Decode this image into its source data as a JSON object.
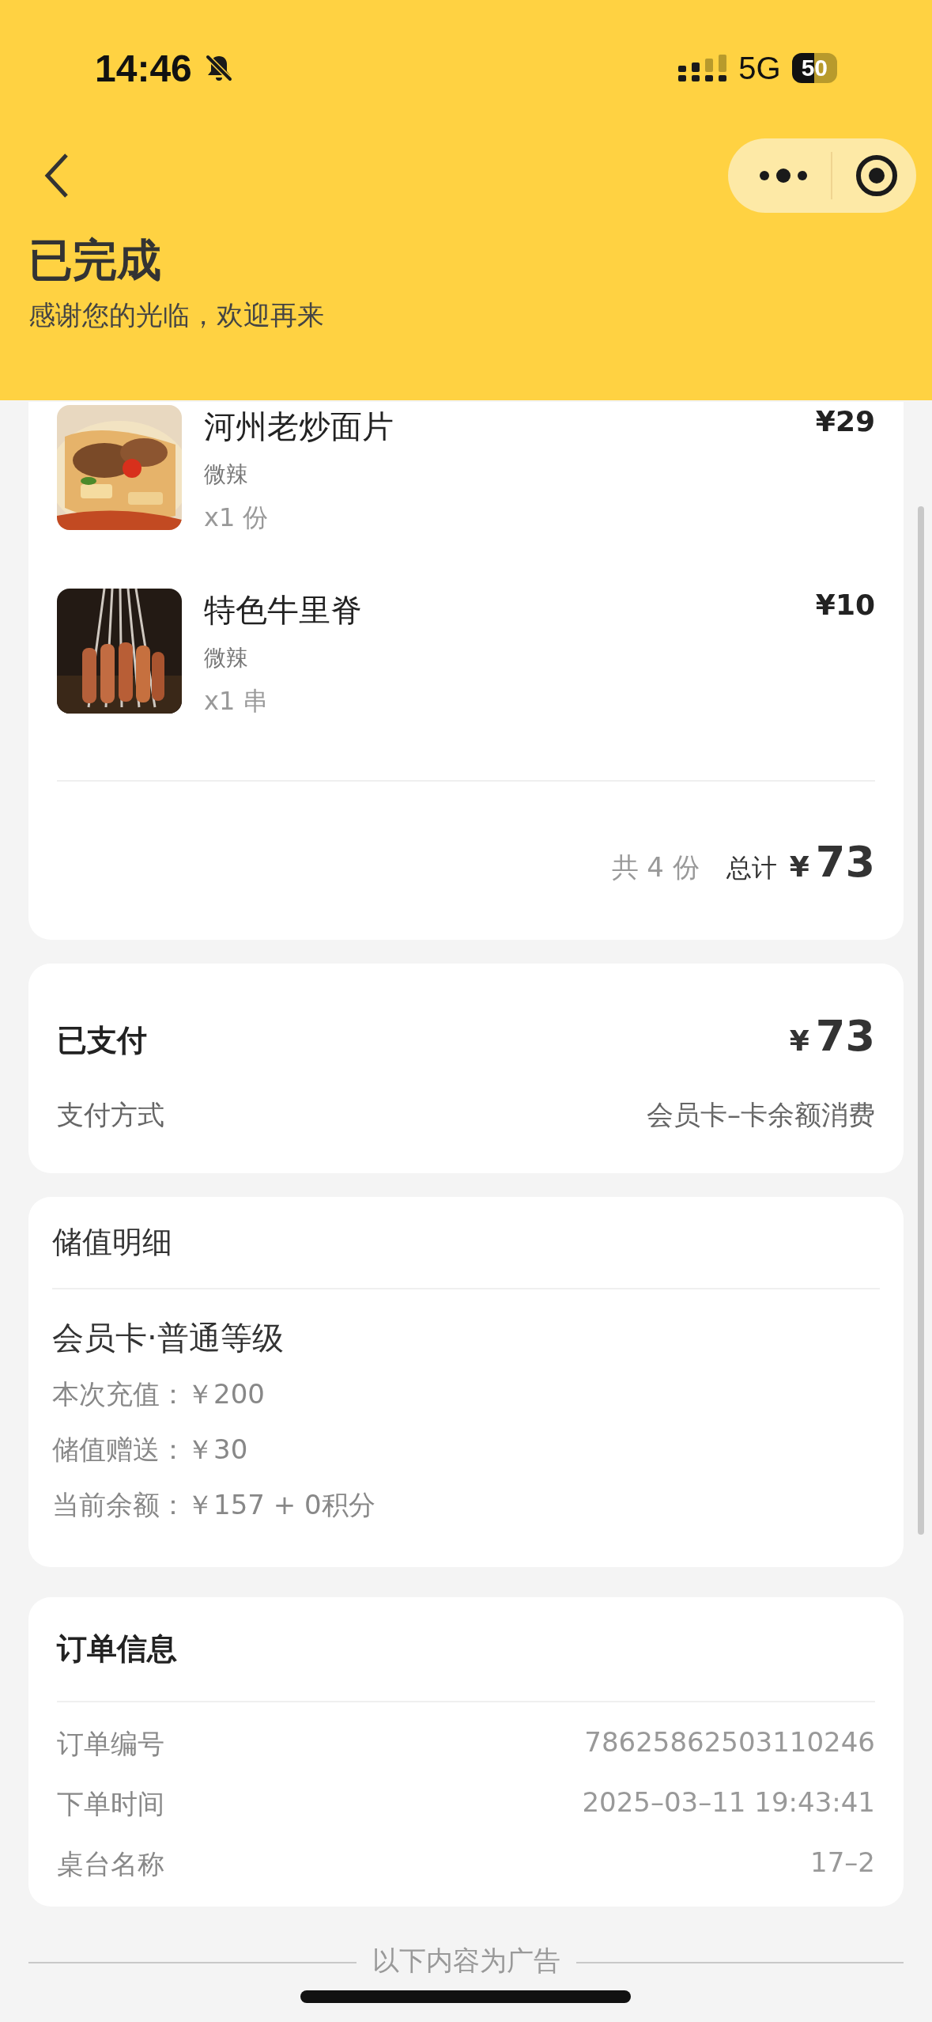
{
  "status_bar": {
    "time": "14:46",
    "network": "5G",
    "battery": "50"
  },
  "header": {
    "title": "已完成",
    "subtitle": "感谢您的光临，欢迎再来"
  },
  "order_items": [
    {
      "name": "河州老炒面片",
      "spec": "微辣",
      "quantity": "x1 份",
      "price": "¥29"
    },
    {
      "name": "特色牛里脊",
      "spec": "微辣",
      "quantity": "x1 串",
      "price": "¥10"
    }
  ],
  "summary": {
    "count": "共 4 份",
    "total_label": "总计",
    "currency": "¥",
    "total": "73"
  },
  "payment": {
    "title": "已支付",
    "currency": "¥",
    "amount": "73",
    "method_label": "支付方式",
    "method": "会员卡–卡余额消费"
  },
  "stored_value": {
    "title": "储值明细",
    "card": "会员卡·普通等级",
    "lines": [
      "本次充值：￥200",
      "储值赠送：￥30",
      "当前余额：￥157 + 0积分"
    ]
  },
  "order_info": {
    "title": "订单信息",
    "rows": [
      {
        "label": "订单编号",
        "value": "78625862503110246"
      },
      {
        "label": "下单时间",
        "value": "2025–03–11 19:43:41"
      },
      {
        "label": "桌台名称",
        "value": "17–2"
      }
    ]
  },
  "ad_notice": "以下内容为广告"
}
